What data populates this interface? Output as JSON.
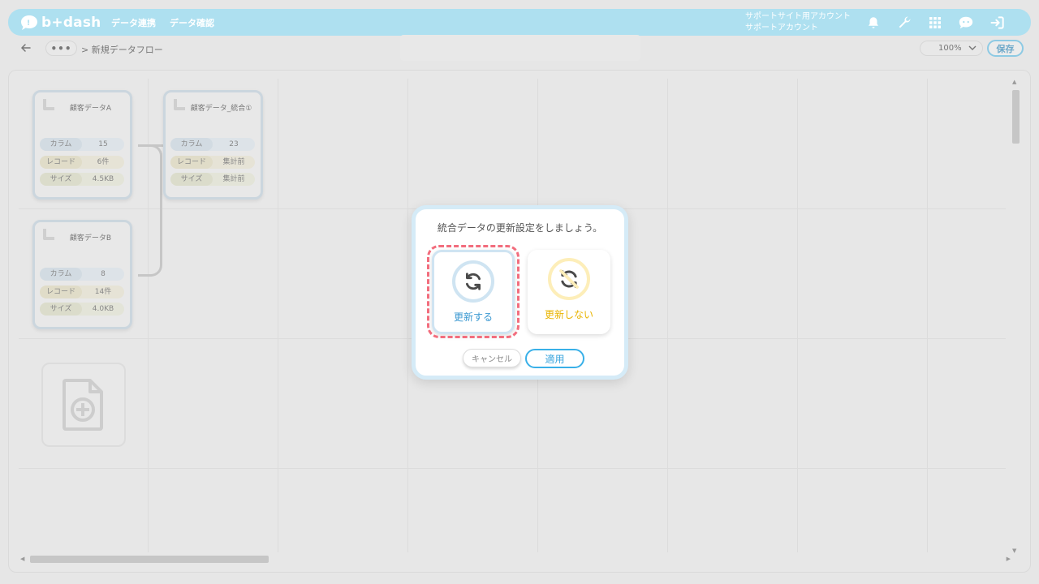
{
  "app": {
    "logo_text": "b+dash"
  },
  "nav": {
    "items": [
      {
        "label": "データ連携"
      },
      {
        "label": "データ確認"
      }
    ]
  },
  "account": {
    "line1": "サポートサイト用アカウント",
    "line2": "サポートアカウント"
  },
  "toolbar": {
    "ellipsis": "•••",
    "breadcrumb": "> 新規データフロー",
    "zoom": "100%",
    "save_label": "保存"
  },
  "nodes": [
    {
      "title": "顧客データA",
      "rows": [
        {
          "key": "カラム",
          "value": "15"
        },
        {
          "key": "レコード",
          "value": "6件"
        },
        {
          "key": "サイズ",
          "value": "4.5KB"
        }
      ]
    },
    {
      "title": "顧客データ_統合①",
      "rows": [
        {
          "key": "カラム",
          "value": "23"
        },
        {
          "key": "レコード",
          "value": "集計前"
        },
        {
          "key": "サイズ",
          "value": "集計前"
        }
      ]
    },
    {
      "title": "顧客データB",
      "rows": [
        {
          "key": "カラム",
          "value": "8"
        },
        {
          "key": "レコード",
          "value": "14件"
        },
        {
          "key": "サイズ",
          "value": "4.0KB"
        }
      ]
    }
  ],
  "dialog": {
    "title": "統合データの更新設定をしましょう。",
    "options": [
      {
        "label": "更新する",
        "icon": "refresh-icon",
        "selected": true
      },
      {
        "label": "更新しない",
        "icon": "no-refresh-icon",
        "selected": false
      }
    ],
    "cancel_label": "キャンセル",
    "apply_label": "適用"
  },
  "colors": {
    "header": "#aee0f0",
    "accent_blue": "#39b0e8",
    "accent_yellow": "#e9b400",
    "focus_ring": "#f26d7d"
  }
}
